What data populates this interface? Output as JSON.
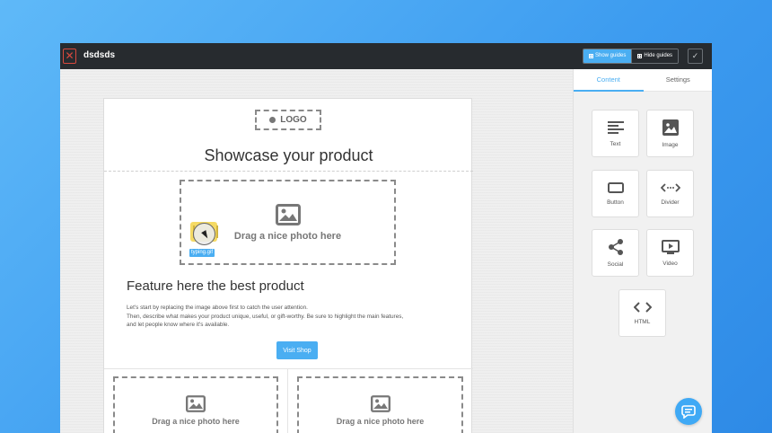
{
  "window": {
    "title": "dsdsds",
    "close_glyph": "✕",
    "confirm_glyph": "✓"
  },
  "toolbar": {
    "show_guides_label": "Show guides",
    "hide_guides_label": "Hide guides"
  },
  "email": {
    "logo_label": "LOGO",
    "showcase_title": "Showcase your product",
    "photo_placeholder_label": "Drag a nice photo here",
    "drag_file_label": "typing.gif",
    "feature_title": "Feature here the best product",
    "feature_body": [
      "Let's start by replacing the image above first to catch the user attention.",
      "Then, describe what makes your product unique, useful, or gift-worthy. Be sure to highlight the main features,",
      "and let people know where it's available."
    ],
    "button_label": "Visit Shop",
    "small_photo_label_1": "Drag a nice photo here",
    "small_photo_label_2": "Drag a nice photo here"
  },
  "panel": {
    "tabs": [
      {
        "label": "Content",
        "active": true
      },
      {
        "label": "Settings",
        "active": false
      }
    ],
    "tiles": [
      {
        "label": "Text",
        "icon": "text-icon"
      },
      {
        "label": "Image",
        "icon": "image-icon"
      },
      {
        "label": "Button",
        "icon": "button-icon"
      },
      {
        "label": "Divider",
        "icon": "divider-icon"
      },
      {
        "label": "Social",
        "icon": "share-icon"
      },
      {
        "label": "Video",
        "icon": "video-icon"
      },
      {
        "label": "HTML",
        "icon": "code-icon"
      }
    ]
  },
  "colors": {
    "accent": "#4aaef2",
    "topbar": "#272b2f",
    "close": "#d9493e"
  }
}
